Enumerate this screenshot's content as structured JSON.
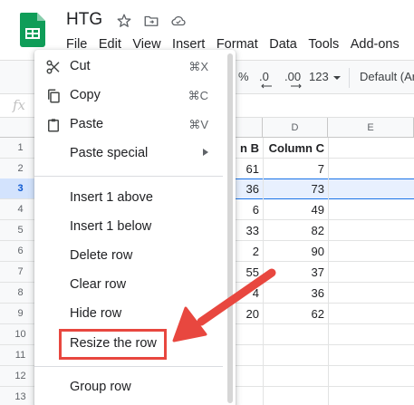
{
  "app": {
    "title": "HTG",
    "menu": [
      "File",
      "Edit",
      "View",
      "Insert",
      "Format",
      "Data",
      "Tools",
      "Add-ons"
    ]
  },
  "toolbar": {
    "percent": "%",
    "decrease_decimal": ".0",
    "increase_decimal": ".00",
    "more_formats": "123",
    "font": "Default (Ar"
  },
  "formula_bar": {
    "fx": "fx"
  },
  "grid": {
    "col_labels": {
      "c": "",
      "d": "D",
      "e": "E"
    },
    "row_numbers": [
      "1",
      "2",
      "3",
      "4",
      "5",
      "6",
      "7",
      "8",
      "9",
      "10",
      "11",
      "12",
      "13"
    ],
    "selected_row": "3",
    "header_row": {
      "col_b": "n B",
      "col_c": "Column C"
    },
    "col_b_values": [
      "61",
      "36",
      "6",
      "33",
      "2",
      "55",
      "4",
      "20"
    ],
    "col_c_values": [
      "7",
      "73",
      "49",
      "82",
      "90",
      "37",
      "36",
      "62"
    ]
  },
  "context_menu": {
    "items": [
      {
        "label": "Cut",
        "shortcut": "⌘X",
        "icon": "scissors-icon"
      },
      {
        "label": "Copy",
        "shortcut": "⌘C",
        "icon": "copy-icon"
      },
      {
        "label": "Paste",
        "shortcut": "⌘V",
        "icon": "clipboard-icon"
      },
      {
        "label": "Paste special"
      },
      {
        "label": "Insert 1 above"
      },
      {
        "label": "Insert 1 below"
      },
      {
        "label": "Delete row"
      },
      {
        "label": "Clear row"
      },
      {
        "label": "Hide row"
      },
      {
        "label": "Resize the row"
      },
      {
        "label": "Group row"
      }
    ]
  },
  "colors": {
    "sheets_green": "#0f9d58",
    "selection_blue": "#1a73e8",
    "annotation_red": "#e8473f"
  }
}
